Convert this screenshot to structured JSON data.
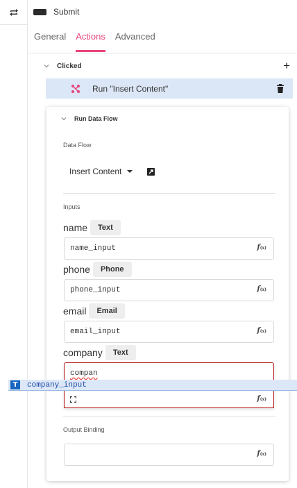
{
  "header": {
    "title": "Submit",
    "icon": "button-widget-icon"
  },
  "tabs": [
    {
      "label": "General",
      "active": false
    },
    {
      "label": "Actions",
      "active": true
    },
    {
      "label": "Advanced",
      "active": false
    }
  ],
  "event": {
    "label": "Clicked",
    "add_icon": "plus-icon"
  },
  "action": {
    "label": "Run \"Insert Content\"",
    "icon": "data-flow-icon",
    "delete_icon": "trash-icon"
  },
  "panel": {
    "title": "Run Data Flow",
    "data_flow_label": "Data Flow",
    "data_flow_value": "Insert Content",
    "inputs_label": "Inputs",
    "inputs": [
      {
        "name": "name",
        "type": "Text",
        "value": "name_input"
      },
      {
        "name": "phone",
        "type": "Phone",
        "value": "phone_input"
      },
      {
        "name": "email",
        "type": "Email",
        "value": "email_input"
      },
      {
        "name": "company",
        "type": "Text",
        "value": "compan"
      }
    ],
    "fx": "f",
    "fx_sub": "(x)",
    "output_binding_label": "Output Binding",
    "output_binding_value": ""
  },
  "autocomplete": {
    "icon_letter": "T",
    "suggestion": "company_input"
  },
  "colors": {
    "accent": "#e8457c",
    "selected_row": "#dbe6f6",
    "error_border": "#b71c1c",
    "suggest_bg": "#dce7f7",
    "suggest_text": "#1a47a8"
  }
}
